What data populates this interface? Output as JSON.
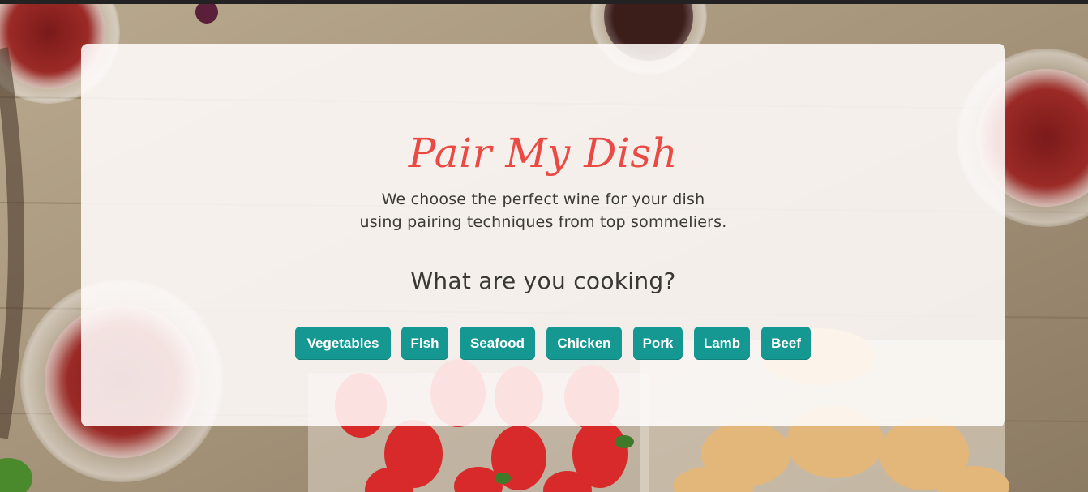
{
  "hero": {
    "title": "Pair My Dish",
    "tagline_line1": "We choose the perfect wine for your dish",
    "tagline_line2": "using pairing techniques from top sommeliers.",
    "question": "What are you cooking?"
  },
  "dish_buttons": [
    {
      "label": "Vegetables"
    },
    {
      "label": "Fish"
    },
    {
      "label": "Seafood"
    },
    {
      "label": "Chicken"
    },
    {
      "label": "Pork"
    },
    {
      "label": "Lamb"
    },
    {
      "label": "Beef"
    }
  ],
  "colors": {
    "title": "#ea4a44",
    "button_bg": "#159892",
    "button_text": "#ffffff",
    "body_text": "#3c3a36"
  }
}
